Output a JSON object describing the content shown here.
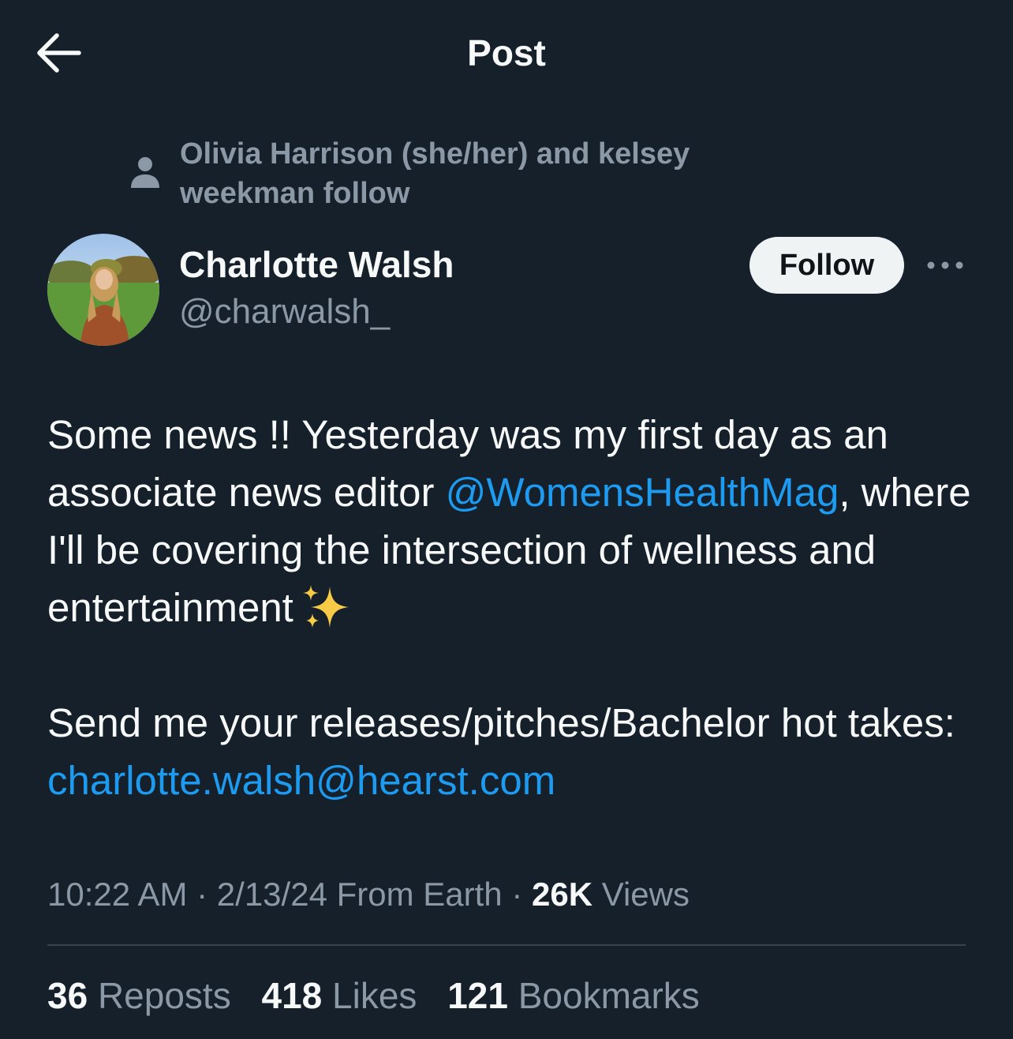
{
  "header": {
    "title": "Post",
    "back_icon": "arrow-left-icon"
  },
  "social_context": {
    "icon": "person-icon",
    "text": "Olivia Harrison (she/her) and kelsey weekman follow"
  },
  "author": {
    "name": "Charlotte Walsh",
    "handle": "@charwalsh_",
    "follow_label": "Follow",
    "more_icon": "more-horizontal-icon"
  },
  "tweet": {
    "line1_pre": "Some news !! Yesterday was my first day as an associate news editor ",
    "mention": "@WomensHealthMag",
    "line1_post": ", where I'll be covering the intersection of wellness and entertainment",
    "emoji": "sparkles-icon",
    "line2_pre": "Send me your releases/pitches/Bachelor hot takes: ",
    "email": "charlotte.walsh@hearst.com"
  },
  "meta": {
    "time": "10:22 AM",
    "sep1": " · ",
    "date": "2/13/24",
    "location": " From Earth",
    "sep2": " · ",
    "views_count": "26K",
    "views_label": " Views"
  },
  "stats": {
    "reposts_count": "36",
    "reposts_label": " Reposts",
    "likes_count": "418",
    "likes_label": " Likes",
    "bookmarks_count": "121",
    "bookmarks_label": " Bookmarks"
  },
  "colors": {
    "background": "#15202b",
    "text_primary": "#f7f9f9",
    "text_secondary": "#8b98a5",
    "link": "#1d9bf0",
    "divider": "#38444d",
    "follow_bg": "#eff3f4"
  }
}
